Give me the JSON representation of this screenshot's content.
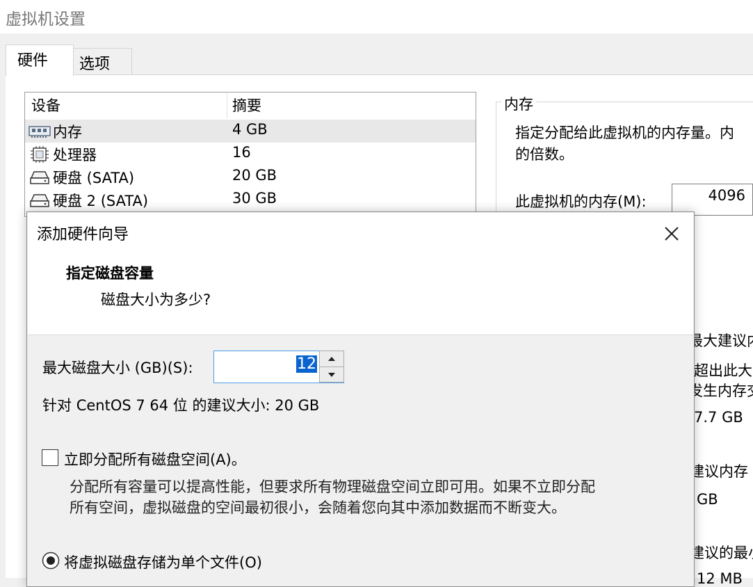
{
  "window": {
    "title": "虚拟机设置"
  },
  "tabs": [
    {
      "label": "硬件"
    },
    {
      "label": "选项"
    }
  ],
  "device_list": {
    "columns": [
      "设备",
      "摘要"
    ],
    "rows": [
      {
        "device": "内存",
        "summary": "4 GB",
        "icon": "memory-icon"
      },
      {
        "device": "处理器",
        "summary": "16",
        "icon": "cpu-icon"
      },
      {
        "device": "硬盘 (SATA)",
        "summary": "20 GB",
        "icon": "harddisk-icon"
      },
      {
        "device": "硬盘 2 (SATA)",
        "summary": "30 GB",
        "icon": "harddisk-icon"
      }
    ]
  },
  "memory_panel": {
    "group_title": "内存",
    "description_line1": "指定分配给此虚拟机的内存量。内",
    "description_line2": "的倍数。",
    "field_label": "此虚拟机的内存(M):",
    "field_value": "4096",
    "peek": [
      "最大建议内",
      "超出此大",
      "发生内存交",
      "7.7 GB",
      "建议内存",
      "GB",
      "建议的最小",
      "12 MB"
    ]
  },
  "dialog": {
    "title": "添加硬件向导",
    "step_title": "指定磁盘容量",
    "step_subtitle": "磁盘大小为多少?",
    "size_label": "最大磁盘大小 (GB)(S):",
    "size_value": "12",
    "recommend_prefix": "针对 ",
    "recommend_os": "CentOS 7 64 位",
    "recommend_suffix": " 的建议大小: 20 GB",
    "allocate_label": "立即分配所有磁盘空间(A)。",
    "allocate_checked": false,
    "allocate_desc_line1": "分配所有容量可以提高性能，但要求所有物理磁盘空间立即可用。如果不立即分配",
    "allocate_desc_line2": "所有空间，虚拟磁盘的空间最初很小，会随着您向其中添加数据而不断变大。",
    "single_file_label": "将虚拟磁盘存储为单个文件(O)",
    "single_file_selected": true
  }
}
